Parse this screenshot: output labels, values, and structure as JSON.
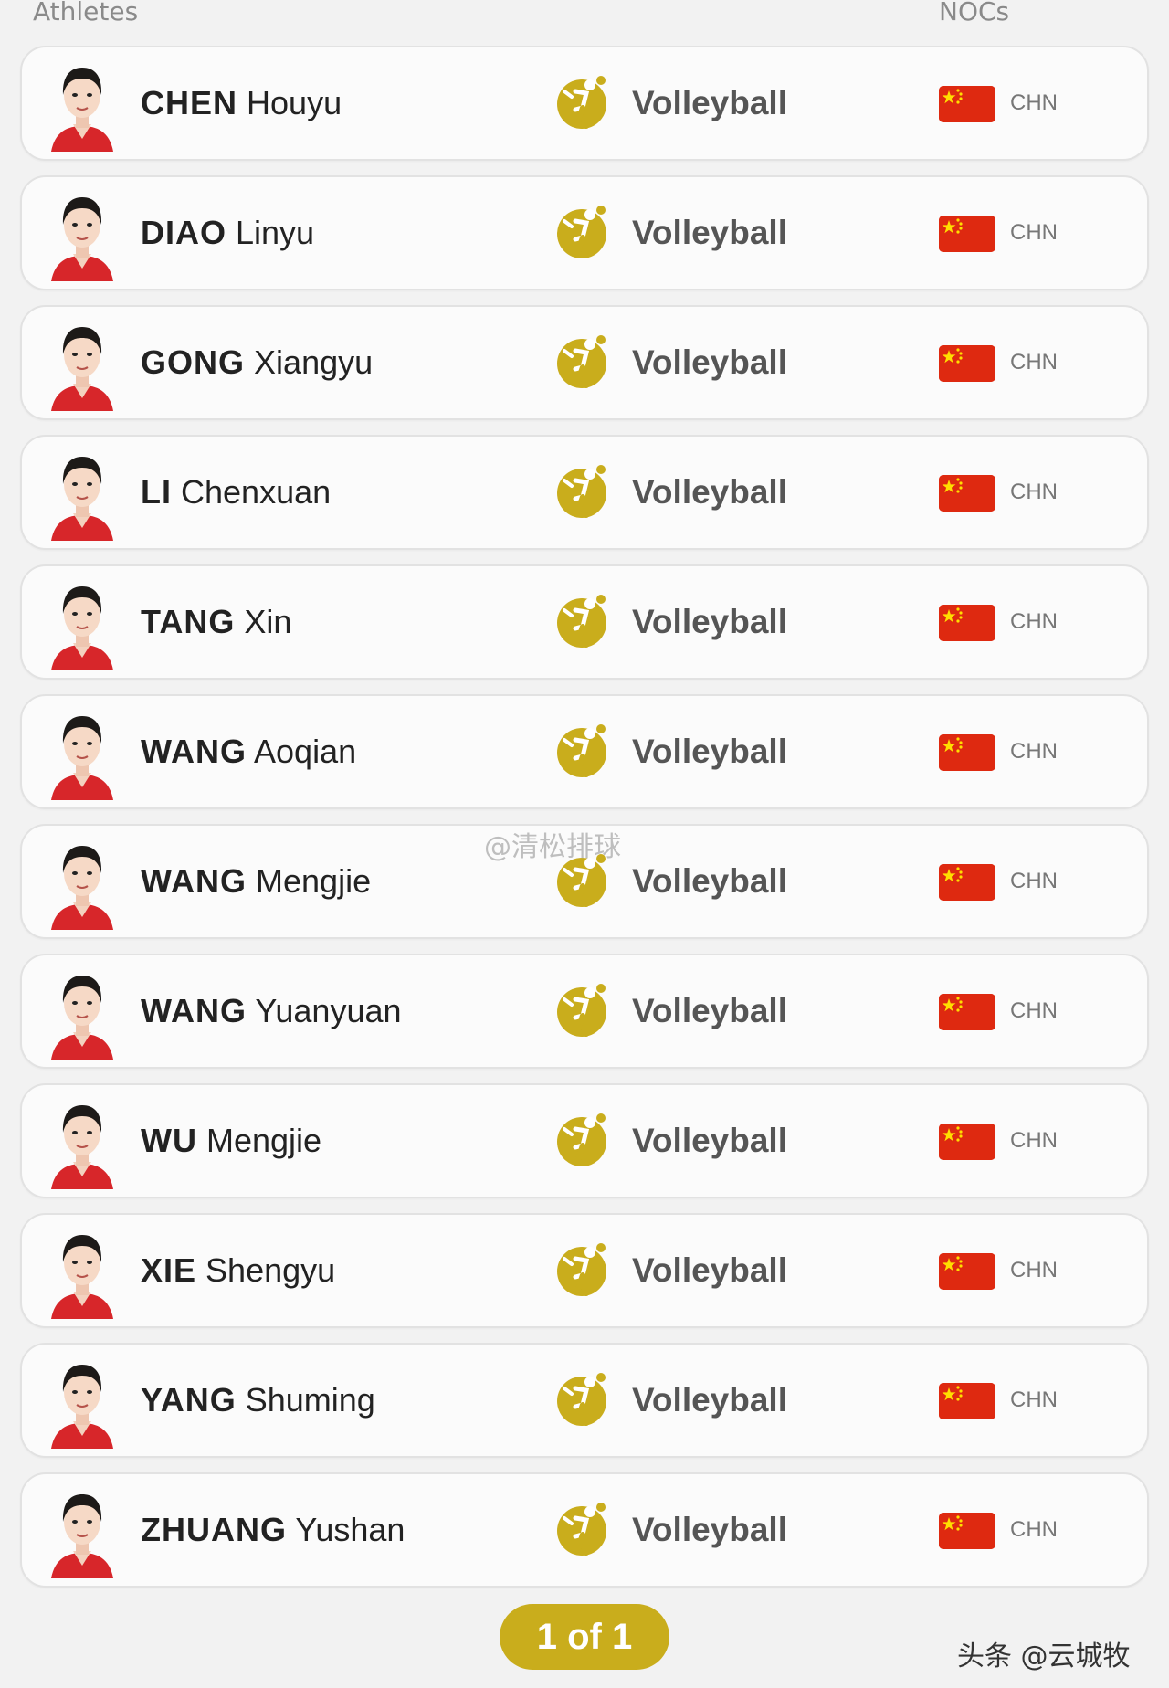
{
  "header": {
    "athletes_label": "Athletes",
    "nocs_label": "NOCs"
  },
  "athletes": [
    {
      "last": "CHEN",
      "first": "Houyu",
      "sport": "Volleyball",
      "noc": "CHN"
    },
    {
      "last": "DIAO",
      "first": "Linyu",
      "sport": "Volleyball",
      "noc": "CHN"
    },
    {
      "last": "GONG",
      "first": "Xiangyu",
      "sport": "Volleyball",
      "noc": "CHN"
    },
    {
      "last": "LI",
      "first": "Chenxuan",
      "sport": "Volleyball",
      "noc": "CHN"
    },
    {
      "last": "TANG",
      "first": "Xin",
      "sport": "Volleyball",
      "noc": "CHN"
    },
    {
      "last": "WANG",
      "first": "Aoqian",
      "sport": "Volleyball",
      "noc": "CHN"
    },
    {
      "last": "WANG",
      "first": "Mengjie",
      "sport": "Volleyball",
      "noc": "CHN"
    },
    {
      "last": "WANG",
      "first": "Yuanyuan",
      "sport": "Volleyball",
      "noc": "CHN"
    },
    {
      "last": "WU",
      "first": "Mengjie",
      "sport": "Volleyball",
      "noc": "CHN"
    },
    {
      "last": "XIE",
      "first": "Shengyu",
      "sport": "Volleyball",
      "noc": "CHN"
    },
    {
      "last": "YANG",
      "first": "Shuming",
      "sport": "Volleyball",
      "noc": "CHN"
    },
    {
      "last": "ZHUANG",
      "first": "Yushan",
      "sport": "Volleyball",
      "noc": "CHN"
    }
  ],
  "sport_icon": "volleyball-pictogram-icon",
  "flag_icon": "china-flag-icon",
  "watermark": "@清松排球",
  "pagination": {
    "label": "1 of 1"
  },
  "corner_watermark": "头条 @云城牧",
  "colors": {
    "accent_gold": "#c9ad1c",
    "flag_red": "#de2910",
    "flag_star": "#ffde00",
    "row_bg": "#fbfbfb"
  }
}
